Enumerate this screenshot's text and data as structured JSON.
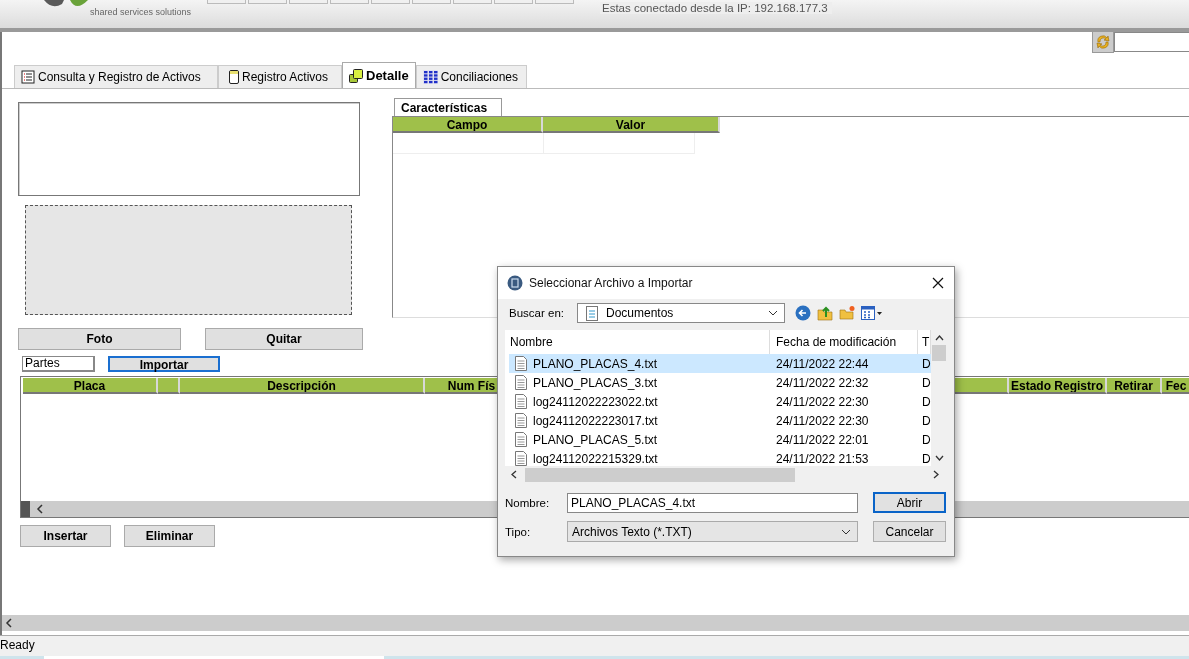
{
  "header": {
    "tagline": "shared services solutions",
    "connection_text": "Estas conectado desde la IP: 192.168.177.3"
  },
  "tabs": [
    {
      "label": "Consulta y Registro de Activos",
      "kind": "list",
      "selected": false
    },
    {
      "label": "Registro Activos",
      "kind": "record",
      "selected": false
    },
    {
      "label": "Detalle",
      "kind": "detail",
      "selected": true
    },
    {
      "label": "Conciliaciones",
      "kind": "grid",
      "selected": false
    }
  ],
  "characteristics": {
    "tab_label": "Características",
    "columns": [
      "Campo",
      "Valor"
    ]
  },
  "photo_buttons": [
    "Foto",
    "Quitar"
  ],
  "parts": {
    "label": "Partes",
    "import_button": "Importar"
  },
  "parts_grid": {
    "columns": [
      {
        "kind": "text",
        "label": "Placa"
      },
      {
        "kind": "blank"
      },
      {
        "kind": "text",
        "label": "Descripción"
      },
      {
        "kind": "text",
        "label": "Num Fís"
      },
      {
        "kind": "hidden"
      },
      {
        "kind": "text",
        "label": "Estado Registro"
      },
      {
        "kind": "text",
        "label": "Retirar"
      },
      {
        "kind": "text",
        "label": "Fec"
      }
    ]
  },
  "grid_buttons": [
    "Insertar",
    "Eliminar"
  ],
  "status_bar": "Ready",
  "dialog": {
    "title": "Seleccionar Archivo a Importar",
    "look_in_label": "Buscar en:",
    "look_in_value": "Documentos",
    "columns": [
      "Nombre",
      "Fecha de modificación",
      "T"
    ],
    "files": [
      {
        "name": "PLANO_PLACAS_4.txt",
        "date": "24/11/2022 22:44",
        "type": "D",
        "selected": true
      },
      {
        "name": "PLANO_PLACAS_3.txt",
        "date": "24/11/2022 22:32",
        "type": "D",
        "selected": false
      },
      {
        "name": "log24112022223022.txt",
        "date": "24/11/2022 22:30",
        "type": "D",
        "selected": false
      },
      {
        "name": "log24112022223017.txt",
        "date": "24/11/2022 22:30",
        "type": "D",
        "selected": false
      },
      {
        "name": "PLANO_PLACAS_5.txt",
        "date": "24/11/2022 22:01",
        "type": "D",
        "selected": false
      },
      {
        "name": "log24112022215329.txt",
        "date": "24/11/2022 21:53",
        "type": "D",
        "selected": false
      }
    ],
    "name_label": "Nombre:",
    "name_value": "PLANO_PLACAS_4.txt",
    "type_label": "Tipo:",
    "type_value": "Archivos Texto (*.TXT)",
    "open_button": "Abrir",
    "cancel_button": "Cancelar"
  }
}
